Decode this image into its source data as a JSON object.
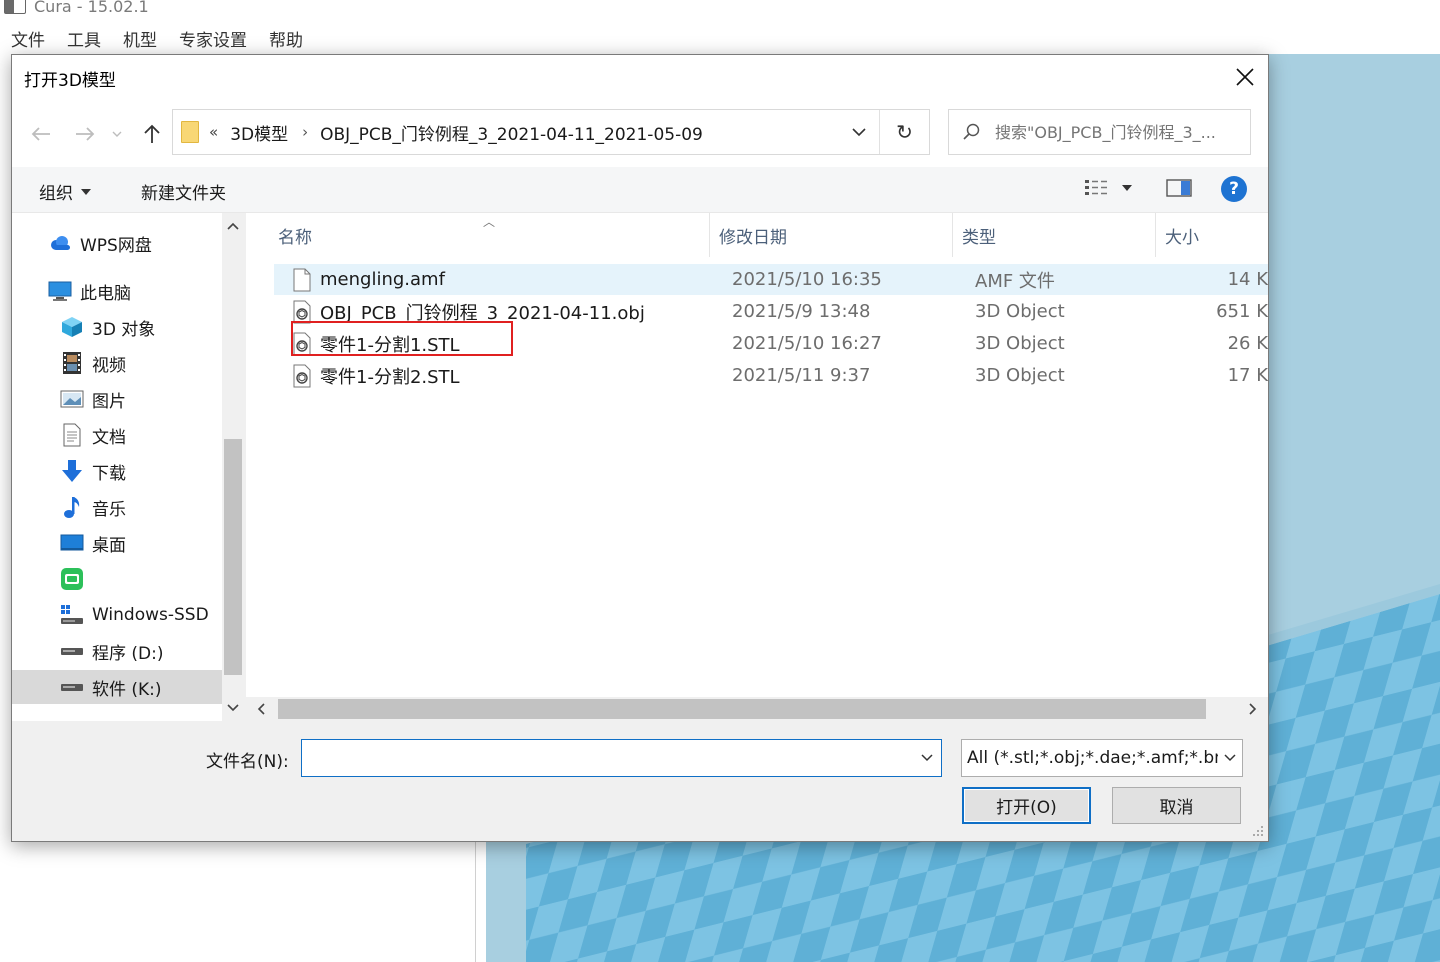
{
  "cura": {
    "window_title": "Cura - 15.02.1",
    "menu": [
      "文件",
      "工具",
      "机型",
      "专家设置",
      "帮助"
    ]
  },
  "dialog": {
    "title": "打开3D模型",
    "address": {
      "overflow": "«",
      "segments": [
        "3D模型",
        "OBJ_PCB_门铃例程_3_2021-04-11_2021-05-09"
      ]
    },
    "search_placeholder": "搜索\"OBJ_PCB_门铃例程_3_...",
    "toolbar": {
      "organize": "组织",
      "new_folder": "新建文件夹"
    },
    "nav_items": [
      {
        "label": "WPS网盘",
        "icon": "cloud-icon"
      },
      {
        "label": "此电脑",
        "icon": "computer-icon"
      },
      {
        "label": "3D 对象",
        "icon": "cube-icon"
      },
      {
        "label": "视频",
        "icon": "film-icon"
      },
      {
        "label": "图片",
        "icon": "picture-icon"
      },
      {
        "label": "文档",
        "icon": "document-icon"
      },
      {
        "label": "下载",
        "icon": "download-arrow-icon"
      },
      {
        "label": "音乐",
        "icon": "music-note-icon"
      },
      {
        "label": "桌面",
        "icon": "desktop-icon"
      },
      {
        "label": "",
        "icon": "green-app-icon"
      },
      {
        "label": "Windows-SSD",
        "icon": "system-drive-icon"
      },
      {
        "label": "程序 (D:)",
        "icon": "drive-icon"
      },
      {
        "label": "软件 (K:)",
        "icon": "drive-icon",
        "selected": true
      }
    ],
    "columns": [
      "名称",
      "修改日期",
      "类型",
      "大小"
    ],
    "files": [
      {
        "name": "mengling.amf",
        "modified": "2021/5/10 16:35",
        "type": "AMF 文件",
        "size": "14 K",
        "icon": "blank-file-icon"
      },
      {
        "name": "OBJ_PCB_门铃例程_3_2021-04-11.obj",
        "modified": "2021/5/9 13:48",
        "type": "3D Object",
        "size": "651 K",
        "icon": "3d-object-file-icon"
      },
      {
        "name": "零件1-分割1.STL",
        "modified": "2021/5/10 16:27",
        "type": "3D Object",
        "size": "26 K",
        "icon": "3d-object-file-icon"
      },
      {
        "name": "零件1-分割2.STL",
        "modified": "2021/5/11 9:37",
        "type": "3D Object",
        "size": "17 K",
        "icon": "3d-object-file-icon"
      }
    ],
    "filename_label": "文件名(N):",
    "filename_value": "",
    "filetype": "All (*.stl;*.obj;*.dae;*.amf;*.bn",
    "open_button": "打开(O)",
    "cancel_button": "取消"
  },
  "colors": {
    "accent": "#0f6fc6",
    "highlight_box": "#e02020",
    "plate_light": "#7dc3e3",
    "plate_dark": "#5fb0d6",
    "viewport_bg": "#a8cfe0"
  }
}
